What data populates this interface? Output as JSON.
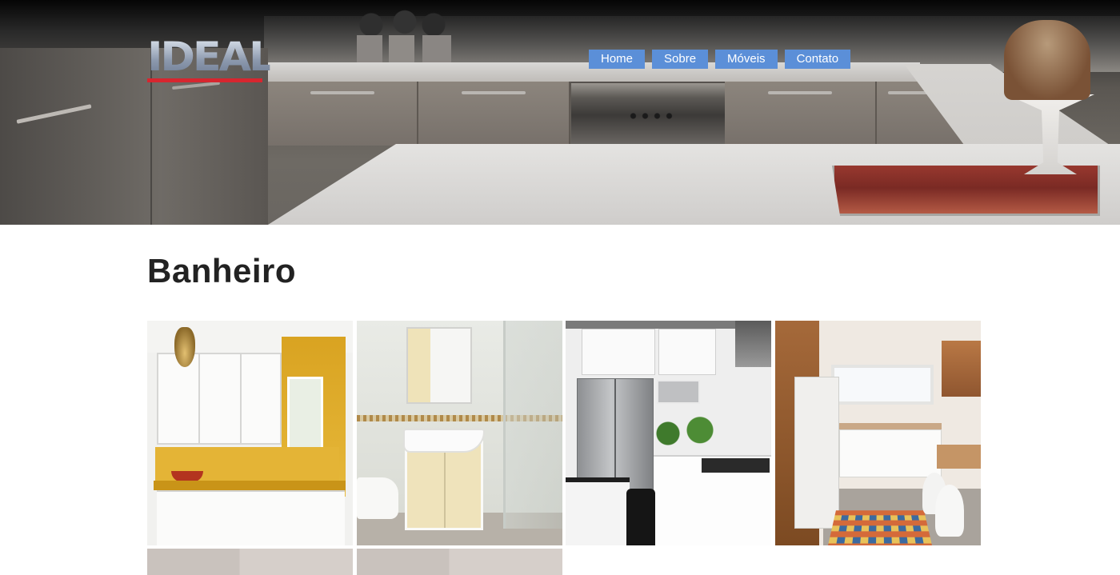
{
  "header": {
    "logo": {
      "text": "IDEAL",
      "accent_color": "#d7262f"
    },
    "nav": [
      {
        "label": "Home"
      },
      {
        "label": "Sobre"
      },
      {
        "label": "Móveis"
      },
      {
        "label": "Contato"
      }
    ],
    "nav_color": "#5b8fd8"
  },
  "main": {
    "title": "Banheiro",
    "gallery": [
      {
        "name": "gallery-image-1"
      },
      {
        "name": "gallery-image-2"
      },
      {
        "name": "gallery-image-3"
      },
      {
        "name": "gallery-image-4"
      },
      {
        "name": "gallery-image-5"
      },
      {
        "name": "gallery-image-6"
      }
    ]
  }
}
